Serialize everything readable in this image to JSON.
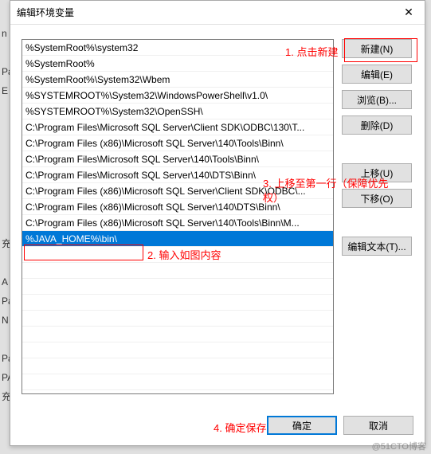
{
  "dialog": {
    "title": "编辑环境变量",
    "close_glyph": "✕"
  },
  "list": {
    "items": [
      "%SystemRoot%\\system32",
      "%SystemRoot%",
      "%SystemRoot%\\System32\\Wbem",
      "%SYSTEMROOT%\\System32\\WindowsPowerShell\\v1.0\\",
      "%SYSTEMROOT%\\System32\\OpenSSH\\",
      "C:\\Program Files\\Microsoft SQL Server\\Client SDK\\ODBC\\130\\T...",
      "C:\\Program Files (x86)\\Microsoft SQL Server\\140\\Tools\\Binn\\",
      "C:\\Program Files\\Microsoft SQL Server\\140\\Tools\\Binn\\",
      "C:\\Program Files\\Microsoft SQL Server\\140\\DTS\\Binn\\",
      "C:\\Program Files (x86)\\Microsoft SQL Server\\Client SDK\\ODBC\\...",
      "C:\\Program Files (x86)\\Microsoft SQL Server\\140\\DTS\\Binn\\",
      "C:\\Program Files (x86)\\Microsoft SQL Server\\140\\Tools\\Binn\\M...",
      "%JAVA_HOME%\\bin\\"
    ],
    "selected_index": 12
  },
  "buttons": {
    "new": "新建(N)",
    "edit": "编辑(E)",
    "browse": "浏览(B)...",
    "delete": "删除(D)",
    "moveup": "上移(U)",
    "movedown": "下移(O)",
    "edittext": "编辑文本(T)...",
    "ok": "确定",
    "cancel": "取消"
  },
  "annotations": {
    "a1": "1. 点击新建",
    "a2": "2. 输入如图内容",
    "a3a": "3. 上移至第一行（保障优先",
    "a3b": "权）",
    "a4": "4. 确定保存"
  },
  "bgletters": "n\n \nPa\nE\n\n\n\n\n\n\n\n充\n\nA\nPa\nN\n \nPa\nPA\n充",
  "watermark": "@51CTO博客"
}
